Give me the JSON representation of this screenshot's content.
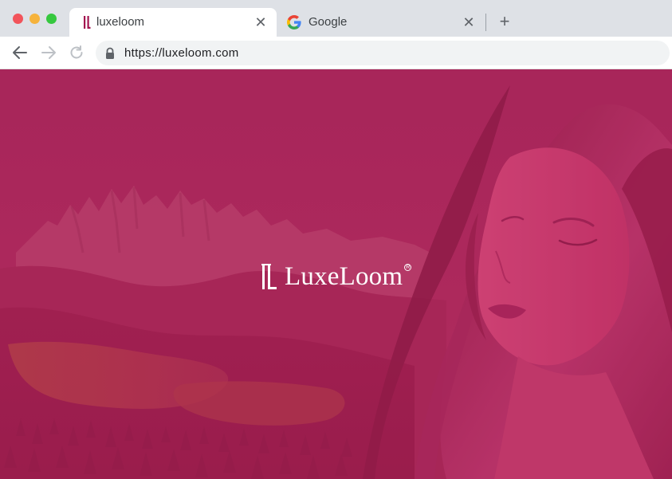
{
  "browser": {
    "tabs": [
      {
        "title": "luxeloom",
        "favicon": "luxeloom-logo-icon",
        "active": true
      },
      {
        "title": "Google",
        "favicon": "google-g-icon",
        "active": false
      }
    ],
    "close_glyph": "✕",
    "new_tab_glyph": "+",
    "url": "https://luxeloom.com"
  },
  "page": {
    "brand_name": "LuxeLoom",
    "brand_reg": "R"
  },
  "colors": {
    "brand": "#a3134f",
    "overlay": "#b0285c"
  }
}
